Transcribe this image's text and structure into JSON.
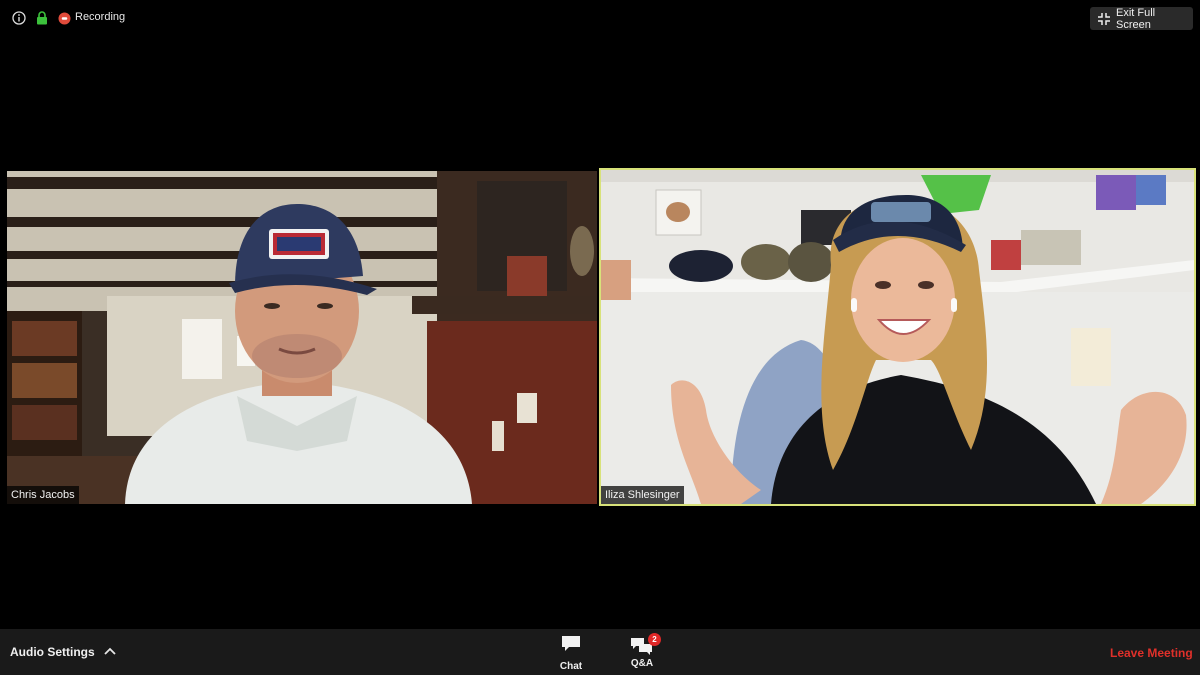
{
  "top_bar": {
    "info_icon": "info-icon",
    "lock_icon": "lock-icon",
    "recording_icon": "recording-dot-icon",
    "recording_label": "Recording",
    "exit_fullscreen_icon": "exit-fullscreen-icon",
    "exit_fullscreen_label": "Exit Full Screen"
  },
  "participants": [
    {
      "name": "Chris Jacobs",
      "active_speaker": false
    },
    {
      "name": "Iliza Shlesinger",
      "active_speaker": true
    }
  ],
  "toolbar": {
    "audio_settings_label": "Audio Settings",
    "chat_label": "Chat",
    "qa_label": "Q&A",
    "qa_badge_count": "2",
    "leave_label": "Leave Meeting"
  },
  "colors": {
    "active_speaker_border": "#d8e27a",
    "leave_meeting": "#e0302a",
    "badge": "#e02828",
    "toolbar_bg": "#1a1a1a"
  }
}
